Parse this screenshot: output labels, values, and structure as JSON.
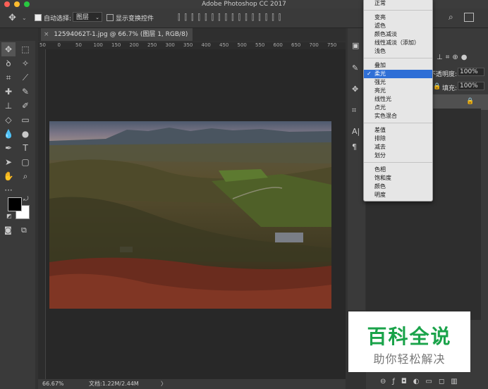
{
  "app": {
    "title": "Adobe Photoshop CC 2017"
  },
  "options_bar": {
    "auto_select_label": "自动选择:",
    "auto_select_value": "图层",
    "show_transform_label": "显示变换控件"
  },
  "document": {
    "tab_title": "12594062T-1.jpg @ 66.7% (图层 1, RGB/8) *",
    "ruler_ticks": [
      "50",
      "0",
      "50",
      "100",
      "150",
      "200",
      "250",
      "300",
      "350",
      "400",
      "450",
      "500",
      "550",
      "600",
      "650",
      "700",
      "750"
    ]
  },
  "status": {
    "zoom": "66.67%",
    "doc_info": "文档:1.22M/2.44M",
    "arrow": "〉"
  },
  "layers": {
    "opacity_label": "不透明度:",
    "opacity_value": "100%",
    "fill_label": "填充:",
    "fill_value": "100%"
  },
  "blend_menu": {
    "groups": [
      [
        "正常"
      ],
      [
        "变亮",
        "滤色",
        "颜色减淡",
        "线性减淡（添加）",
        "浅色"
      ],
      [
        "叠加",
        "柔光",
        "强光",
        "亮光",
        "线性光",
        "点光",
        "实色混合"
      ],
      [
        "差值",
        "排除",
        "减去",
        "划分"
      ],
      [
        "色相",
        "饱和度",
        "颜色",
        "明度"
      ]
    ],
    "selected": "柔光",
    "check": "✓"
  },
  "watermark": {
    "title": "百科全说",
    "subtitle": "助你轻松解决",
    "title_color": "#1aa34a"
  }
}
